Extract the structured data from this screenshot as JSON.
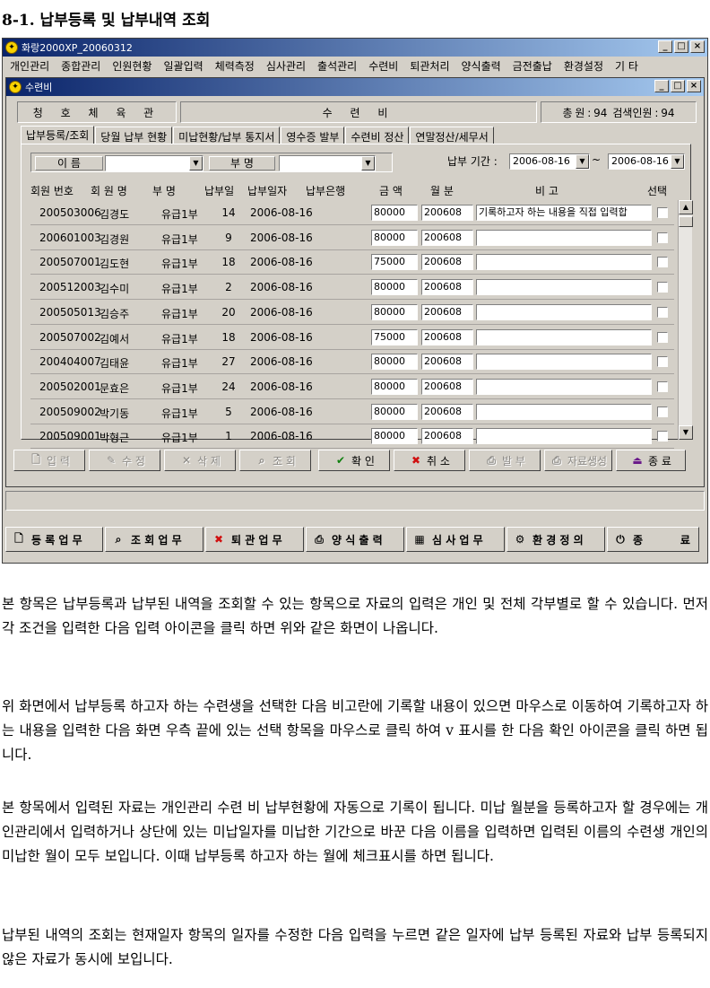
{
  "heading": "8-1. 납부등록 및 납부내역 조회",
  "window": {
    "title": "화랑2000XP_20060312",
    "controls": [
      "_",
      "□",
      "×"
    ],
    "menu": [
      "개인관리",
      "종합관리",
      "인원현황",
      "일괄입력",
      "체력측정",
      "심사관리",
      "출석관리",
      "수련비",
      "퇴관처리",
      "양식출력",
      "금전출납",
      "환경설정",
      "기 타"
    ]
  },
  "child": {
    "title": "수련비",
    "header": {
      "org": "청 호 체 육 관",
      "form": "수 련 비",
      "total": "총 원 : 94",
      "search_count": "검색인원 : 94"
    },
    "tabs": [
      "납부등록/조회",
      "당월 납부 현황",
      "미납현황/납부 통지서",
      "영수증 발부",
      "수련비 정산",
      "연말정산/세무서"
    ],
    "filter": {
      "name_label": "이 름",
      "name_value": "",
      "dept_label": "부 명",
      "dept_value": "",
      "period_label": "납부 기간 :",
      "date_from": "2006-08-16",
      "tilde": "~",
      "date_to": "2006-08-16"
    },
    "columns": [
      "회원 번호",
      "회 원 명",
      "부  명",
      "납부일",
      "납부일자",
      "납부은행",
      "금  액",
      "월 분",
      "비  고",
      "선택"
    ],
    "rows": [
      {
        "id": "200503006",
        "name": "김경도",
        "dept": "유급1부",
        "day": "14",
        "date": "2006-08-16",
        "bank": "",
        "amount": "80000",
        "month": "200608",
        "note": "기록하고자 하는 내용을 직접 입력합",
        "checked": false
      },
      {
        "id": "200601003",
        "name": "김경원",
        "dept": "유급1부",
        "day": "9",
        "date": "2006-08-16",
        "bank": "",
        "amount": "80000",
        "month": "200608",
        "note": "",
        "checked": false
      },
      {
        "id": "200507001",
        "name": "김도현",
        "dept": "유급1부",
        "day": "18",
        "date": "2006-08-16",
        "bank": "",
        "amount": "75000",
        "month": "200608",
        "note": "",
        "checked": false
      },
      {
        "id": "200512003",
        "name": "김수미",
        "dept": "유급1부",
        "day": "2",
        "date": "2006-08-16",
        "bank": "",
        "amount": "80000",
        "month": "200608",
        "note": "",
        "checked": false
      },
      {
        "id": "200505013",
        "name": "김승주",
        "dept": "유급1부",
        "day": "20",
        "date": "2006-08-16",
        "bank": "",
        "amount": "80000",
        "month": "200608",
        "note": "",
        "checked": false
      },
      {
        "id": "200507002",
        "name": "김예서",
        "dept": "유급1부",
        "day": "18",
        "date": "2006-08-16",
        "bank": "",
        "amount": "75000",
        "month": "200608",
        "note": "",
        "checked": false
      },
      {
        "id": "200404007",
        "name": "김태윤",
        "dept": "유급1부",
        "day": "27",
        "date": "2006-08-16",
        "bank": "",
        "amount": "80000",
        "month": "200608",
        "note": "",
        "checked": false
      },
      {
        "id": "200502001",
        "name": "문효은",
        "dept": "유급1부",
        "day": "24",
        "date": "2006-08-16",
        "bank": "",
        "amount": "80000",
        "month": "200608",
        "note": "",
        "checked": false
      },
      {
        "id": "200509002",
        "name": "박기동",
        "dept": "유급1부",
        "day": "5",
        "date": "2006-08-16",
        "bank": "",
        "amount": "80000",
        "month": "200608",
        "note": "",
        "checked": false
      },
      {
        "id": "200509001",
        "name": "박형근",
        "dept": "유급1부",
        "day": "1",
        "date": "2006-08-16",
        "bank": "",
        "amount": "80000",
        "month": "200608",
        "note": "",
        "checked": false
      }
    ],
    "toolbar": [
      {
        "label": "입   력",
        "icon": "new-document-icon",
        "glyph": "🗋",
        "enabled": false
      },
      {
        "label": "수   정",
        "icon": "edit-icon",
        "glyph": "✎",
        "enabled": false
      },
      {
        "label": "삭   제",
        "icon": "delete-icon",
        "glyph": "✕",
        "enabled": false
      },
      {
        "label": "조   회",
        "icon": "binoculars-icon",
        "glyph": "⌕",
        "enabled": false
      },
      {
        "label": "확   인",
        "icon": "checkmark-icon",
        "glyph": "✔",
        "enabled": true,
        "color": "#108010"
      },
      {
        "label": "취   소",
        "icon": "cancel-x-icon",
        "glyph": "✖",
        "enabled": true,
        "color": "#d01010"
      },
      {
        "label": "발   부",
        "icon": "printer-icon",
        "glyph": "⎙",
        "enabled": false
      },
      {
        "label": "자료생성",
        "icon": "printer-icon",
        "glyph": "⎙",
        "enabled": false
      },
      {
        "label": "종   료",
        "icon": "exit-door-icon",
        "glyph": "⏏",
        "enabled": true,
        "color": "#6a1a8a"
      }
    ]
  },
  "bottombar": [
    {
      "label": "등 록 업 무",
      "icon": "document-icon",
      "glyph": "🗋"
    },
    {
      "label": "조 회 업 무",
      "icon": "search-icon",
      "glyph": "⌕"
    },
    {
      "label": "퇴 관 업 무",
      "icon": "cancel-x-icon",
      "glyph": "✖",
      "color": "#d01010"
    },
    {
      "label": "양 식 출 력",
      "icon": "printer-icon",
      "glyph": "⎙"
    },
    {
      "label": "심 사 업 무",
      "icon": "calculator-icon",
      "glyph": "▦"
    },
    {
      "label": "환 경 정 의",
      "icon": "settings-icon",
      "glyph": "⚙"
    },
    {
      "label": "종          료",
      "icon": "exit-icon",
      "glyph": "⏻"
    }
  ],
  "paragraphs": [
    "본 항목은 납부등록과 납부된 내역을 조회할 수 있는 항목으로 자료의 입력은 개인 및 전체 각부별로 할 수 있습니다. 먼저 각 조건을 입력한 다음 입력 아이콘을 클릭 하면 위와 같은 화면이 나옵니다.",
    "위 화면에서 납부등록 하고자 하는 수련생을 선택한 다음 비고란에 기록할 내용이 있으면 마우스로 이동하여 기록하고자 하는 내용을 입력한 다음 화면 우측 끝에 있는 선택 항목을 마우스로 클릭 하여 v 표시를 한 다음 확인 아이콘을 클릭 하면 됩니다.",
    "본 항목에서 입력된 자료는 개인관리 수련 비 납부현황에 자동으로 기록이 됩니다. 미납 월분을 등록하고자 할 경우에는 개인관리에서 입력하거나 상단에 있는 미납일자를 미납한 기간으로 바꾼 다음 이름을 입력하면 입력된 이름의 수련생 개인의 미납한 월이 모두 보입니다. 이때 납부등록 하고자 하는 월에 체크표시를 하면 됩니다.",
    "납부된 내역의 조회는 현재일자 항목의 일자를 수정한 다음 입력을 누르면 같은 일자에 납부 등록된 자료와 납부 등록되지 않은 자료가 동시에 보입니다."
  ]
}
